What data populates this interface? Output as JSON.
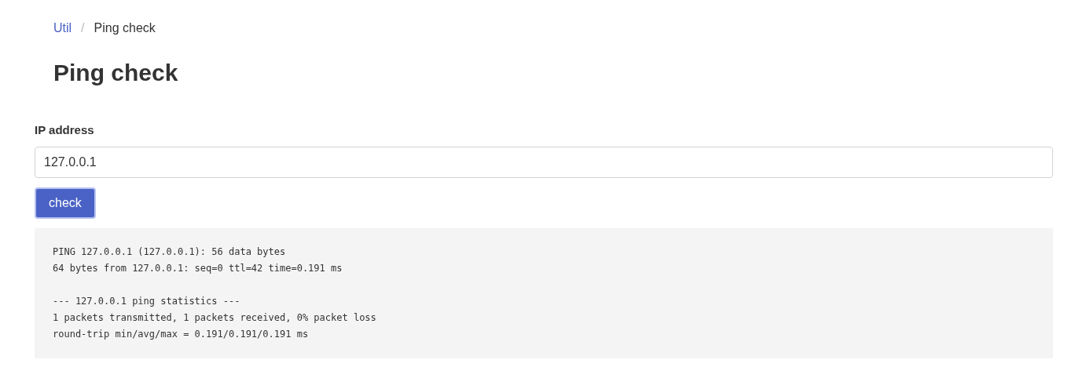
{
  "breadcrumb": [
    {
      "label": "Util",
      "kind": "link"
    },
    {
      "label": "/",
      "kind": "separator"
    },
    {
      "label": "Ping check",
      "kind": "current"
    }
  ],
  "title": "Ping check",
  "form": {
    "label": "IP address",
    "value": "127.0.0.1",
    "button": "check"
  },
  "output": {
    "blocks": [
      [
        "PING 127.0.0.1 (127.0.0.1): 56 data bytes",
        "64 bytes from 127.0.0.1: seq=0 ttl=42 time=0.191 ms"
      ],
      [
        "--- 127.0.0.1 ping statistics ---",
        "1 packets transmitted, 1 packets received, 0% packet loss",
        "round-trip min/avg/max = 0.191/0.191/0.191 ms"
      ]
    ]
  }
}
